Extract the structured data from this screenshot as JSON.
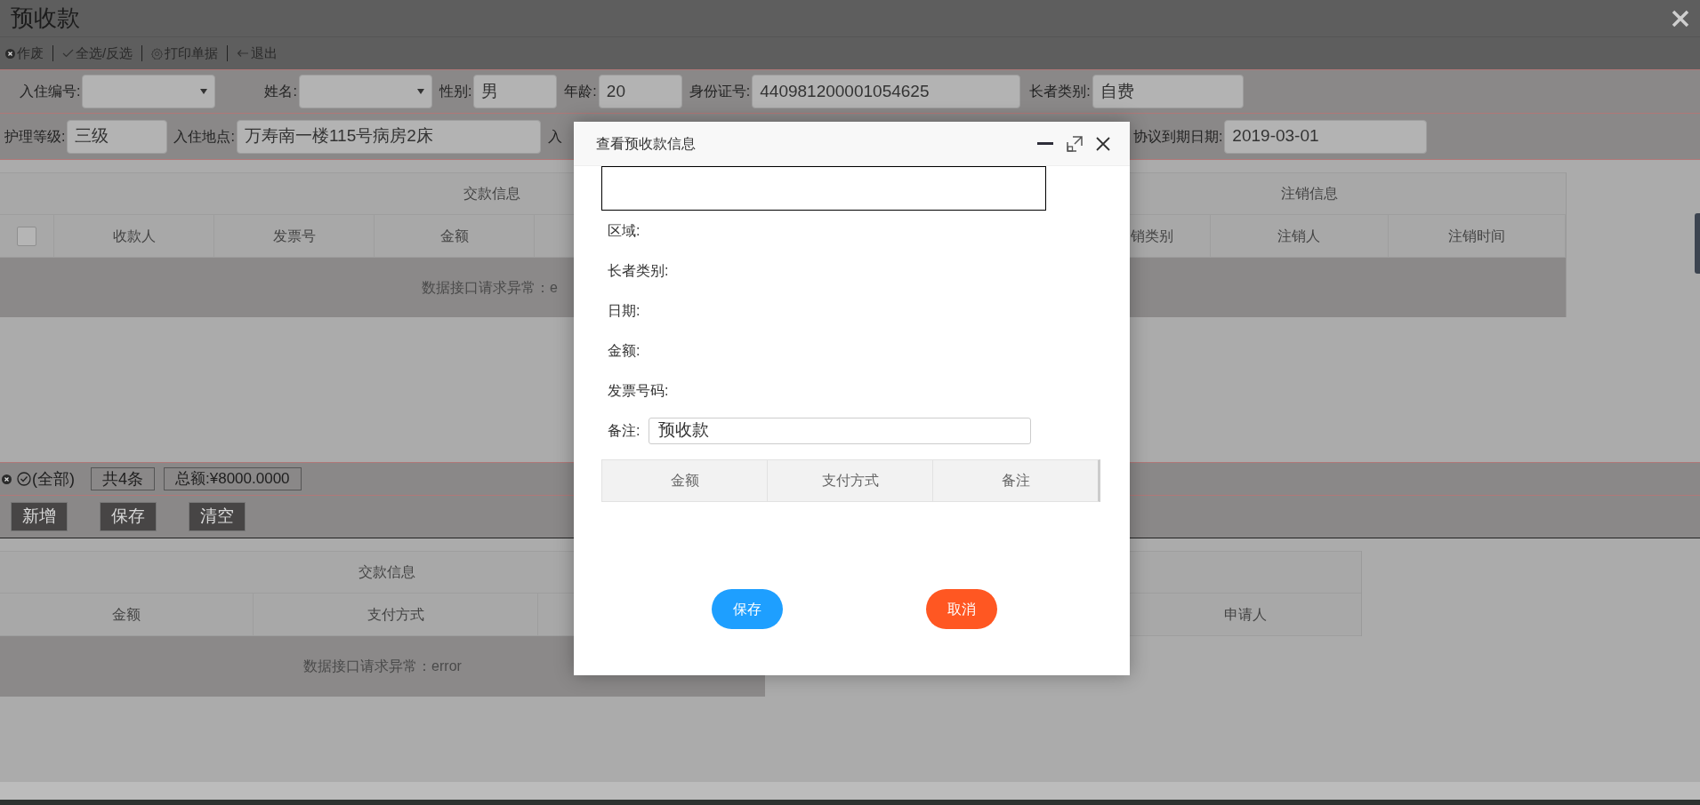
{
  "page": {
    "title": "预收款"
  },
  "toolbar": [
    {
      "kind": "void",
      "label": "作废"
    },
    {
      "kind": "check",
      "label": "全选/反选"
    },
    {
      "kind": "gear",
      "label": "打印单据"
    },
    {
      "kind": "back",
      "label": "退出"
    }
  ],
  "filters_row1": [
    {
      "kind": "select",
      "label": "入住编号:"
    },
    {
      "kind": "select",
      "label": "姓名:"
    },
    {
      "kind": "text",
      "label": "性别:",
      "value": "男"
    },
    {
      "kind": "text",
      "label": "年龄:",
      "value": "20"
    },
    {
      "kind": "text",
      "label": "身份证号:",
      "value": "440981200001054625"
    },
    {
      "kind": "text",
      "label": "长者类别:",
      "value": "自费"
    }
  ],
  "filters_row2": [
    {
      "kind": "text",
      "label": "护理等级:",
      "value": "三级"
    },
    {
      "kind": "text",
      "label": "入住地点:",
      "value": "万寿南一楼115号病房2床"
    },
    {
      "kind": "label",
      "label": "入"
    },
    {
      "kind": "text",
      "label": "协议到期日期:",
      "value": "2019-03-01"
    }
  ],
  "top_table": {
    "group_left": "交款信息",
    "group_right": "注销信息",
    "select_all": {
      "checked": false
    },
    "columns_left": [
      "收款人",
      "发票号",
      "金额"
    ],
    "columns_right": [
      "销类别",
      "注销人",
      "注销时间"
    ],
    "message": "数据接口请求异常：e"
  },
  "status_bar": {
    "filter": "(全部)",
    "count": "共4条",
    "total": "总额:¥8000.0000"
  },
  "actions": [
    "新增",
    "保存",
    "清空"
  ],
  "bottom_table": {
    "group_left": "交款信息",
    "columns_left": [
      "金额",
      "支付方式"
    ],
    "columns_right": [
      "申请人"
    ],
    "message": "数据接口请求异常：error"
  },
  "dialog": {
    "title": "查看预收款信息",
    "fields": [
      "区域:",
      "长者类别:",
      "日期:",
      "金额:",
      "发票号码:"
    ],
    "remark": {
      "label": "备注:",
      "value": "预收款"
    },
    "columns": [
      "金额",
      "支付方式",
      "备注"
    ],
    "buttons": [
      {
        "kind": "primary",
        "label": "保存"
      },
      {
        "kind": "danger",
        "label": "取消"
      }
    ]
  }
}
